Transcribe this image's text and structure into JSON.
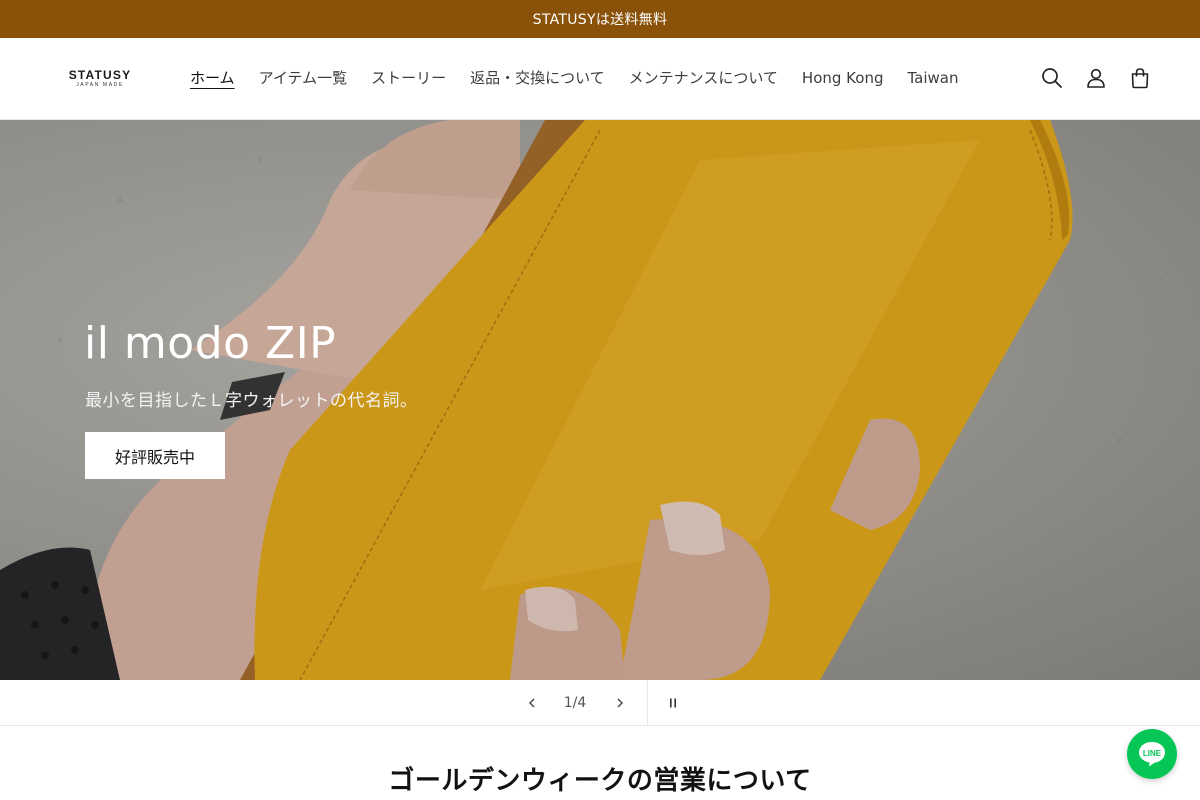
{
  "announcement": {
    "text": "STATUSYは送料無料"
  },
  "header": {
    "logo": {
      "main": "STATUSY",
      "sub": "JAPAN MADE"
    },
    "nav": [
      {
        "label": "ホーム",
        "active": true
      },
      {
        "label": "アイテム一覧"
      },
      {
        "label": "ストーリー"
      },
      {
        "label": "返品・交換について"
      },
      {
        "label": "メンテナンスについて"
      },
      {
        "label": "Hong Kong"
      },
      {
        "label": "Taiwan"
      }
    ],
    "icons": [
      "search-icon",
      "account-icon",
      "cart-icon"
    ]
  },
  "hero": {
    "title": "il modo ZIP",
    "subtitle": "最小を目指したＬ字ウォレットの代名詞。",
    "button_label": "好評販売中",
    "colors": {
      "wallet": "#e8ac1c",
      "overlay": "rgba(0,0,0,0.12)"
    }
  },
  "slider": {
    "counter": "1/4",
    "icons": [
      "chevron-left-icon",
      "chevron-right-icon",
      "pause-icon"
    ]
  },
  "section": {
    "title": "ゴールデンウィークの営業について"
  },
  "floating": {
    "line_label": "LINE",
    "color": "#06c755"
  },
  "colors": {
    "announcement_bg": "#8a5208",
    "text": "#121212"
  }
}
